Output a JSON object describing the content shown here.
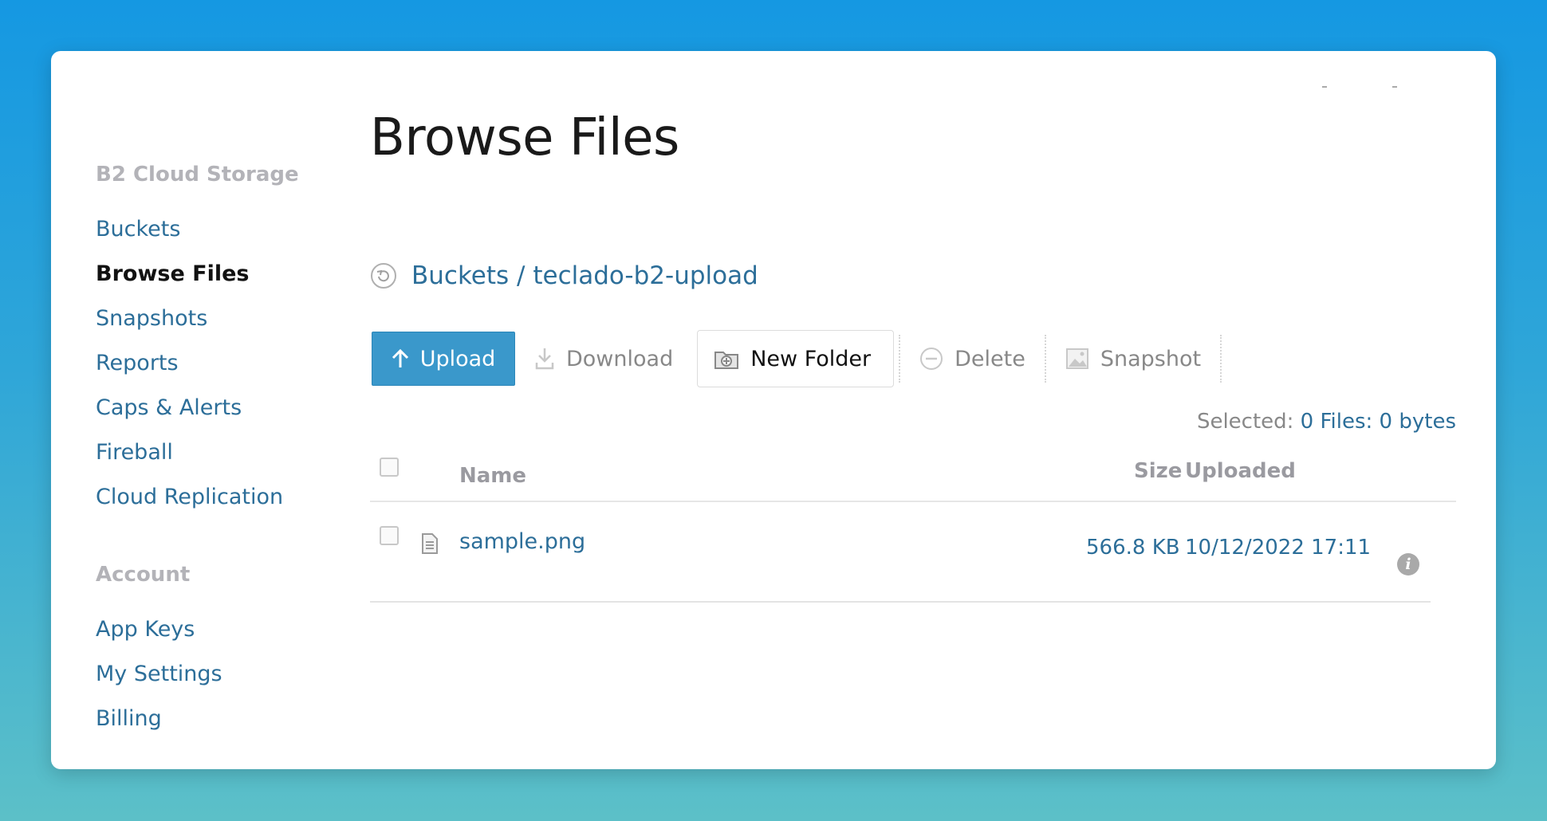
{
  "sidebar": {
    "heading1": "B2 Cloud Storage",
    "items1": [
      "Buckets",
      "Browse Files",
      "Snapshots",
      "Reports",
      "Caps & Alerts",
      "Fireball",
      "Cloud Replication"
    ],
    "active_item": "Browse Files",
    "heading2": "Account",
    "items2": [
      "App Keys",
      "My Settings",
      "Billing"
    ]
  },
  "page": {
    "title": "Browse Files"
  },
  "breadcrumb": {
    "text": "Buckets / teclado-b2-upload",
    "icon": "refresh-icon"
  },
  "toolbar": {
    "upload_label": "Upload",
    "download_label": "Download",
    "new_folder_label": "New Folder",
    "delete_label": "Delete",
    "snapshot_label": "Snapshot"
  },
  "selection": {
    "label": "Selected:",
    "value": "0 Files: 0 bytes"
  },
  "table": {
    "headers": {
      "name": "Name",
      "size": "Size",
      "uploaded": "Uploaded"
    },
    "rows": [
      {
        "name": "sample.png",
        "size": "566.8 KB",
        "uploaded": "10/12/2022 17:11",
        "info_glyph": "i"
      }
    ]
  },
  "colors": {
    "accent": "#3a98cb",
    "link": "#2c6e99",
    "muted": "#888888",
    "background_top": "#1598e2",
    "background_bottom": "#5cc0c8"
  }
}
